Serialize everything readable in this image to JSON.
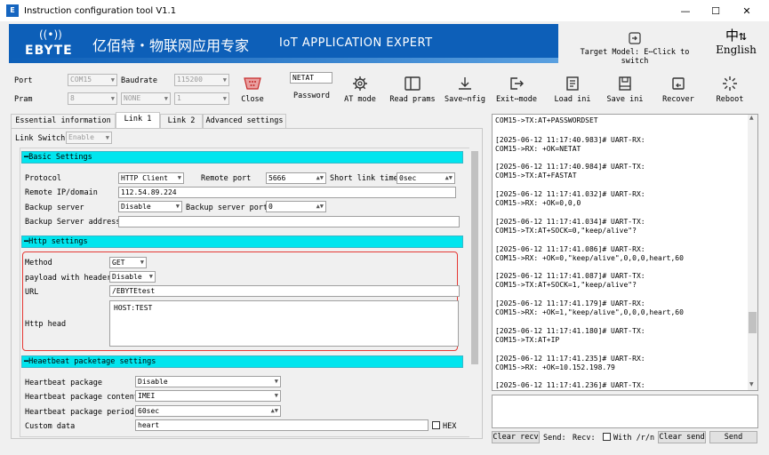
{
  "window": {
    "title": "Instruction configuration tool V1.1",
    "icon_text": "E"
  },
  "banner": {
    "brand": "EBYTE",
    "cn_slogan": "亿佰特・物联网应用专家",
    "en_slogan": "IoT APPLICATION EXPERT"
  },
  "target_model": {
    "label": "Target Model: E⋯Click to switch"
  },
  "language": {
    "label": "English"
  },
  "serial": {
    "port_label": "Port",
    "port_value": "COM15",
    "baud_label": "Baudrate",
    "baud_value": "115200",
    "pram_label": "Pram",
    "pram_data": "8",
    "pram_parity": "NONE",
    "pram_stop": "1",
    "close_label": "Close"
  },
  "password": {
    "value": "NETAT",
    "label": "Password"
  },
  "toolbar": [
    {
      "label": "AT mode",
      "icon": "gear-icon"
    },
    {
      "label": "Read prams",
      "icon": "panel-icon"
    },
    {
      "label": "Save⋯nfig",
      "icon": "download-icon"
    },
    {
      "label": "Exit⋯mode",
      "icon": "exit-icon"
    },
    {
      "label": "Load ini",
      "icon": "document-icon"
    },
    {
      "label": "Save ini",
      "icon": "save-icon"
    },
    {
      "label": "Recover",
      "icon": "recover-icon"
    },
    {
      "label": "Reboot",
      "icon": "spinner-icon"
    }
  ],
  "tabs": [
    "Essential information",
    "Link 1",
    "Link 2",
    "Advanced settings"
  ],
  "link_switch": {
    "label": "Link Switch",
    "value": "Enable"
  },
  "basic": {
    "title": "Basic Settings",
    "protocol_label": "Protocol",
    "protocol_value": "HTTP Client",
    "remote_port_label": "Remote port",
    "remote_port_value": "5666",
    "short_link_label": "Short link time",
    "short_link_value": "0sec",
    "remote_ip_label": "Remote IP/domain",
    "remote_ip_value": "112.54.89.224",
    "backup_label": "Backup server",
    "backup_value": "Disable",
    "backup_port_label": "Backup server port",
    "backup_port_value": "0",
    "backup_addr_label": "Backup Server address",
    "backup_addr_value": ""
  },
  "http": {
    "title": "Http settings",
    "method_label": "Method",
    "method_value": "GET",
    "payload_label": "payload with header",
    "payload_value": "Disable",
    "url_label": "URL",
    "url_value": "/EBYTEtest",
    "head_label": "Http head",
    "head_value": "HOST:TEST"
  },
  "heartbeat": {
    "title": "Heaetbeat packetage settings",
    "pkg_label": "Heartbeat package",
    "pkg_value": "Disable",
    "content_label": "Heartbeat package content",
    "content_value": "IMEI",
    "period_label": "Heartbeat package period",
    "period_value": "60sec",
    "custom_label": "Custom data",
    "custom_value": "heart",
    "hex_label": "HEX"
  },
  "log": [
    [
      "COM15->TX:AT+PASSWORDSET"
    ],
    [
      "[2025-06-12 11:17:40.983]# UART-RX:",
      "COM15->RX: +OK=NETAT"
    ],
    [
      "[2025-06-12 11:17:40.984]# UART-TX:",
      "COM15->TX:AT+FASTAT"
    ],
    [
      "[2025-06-12 11:17:41.032]# UART-RX:",
      "COM15->RX: +OK=0,0,0"
    ],
    [
      "[2025-06-12 11:17:41.034]# UART-TX:",
      "COM15->TX:AT+SOCK=0,\"keep/alive\"?"
    ],
    [
      "[2025-06-12 11:17:41.086]# UART-RX:",
      "COM15->RX: +OK=0,\"keep/alive\",0,0,0,heart,60"
    ],
    [
      "[2025-06-12 11:17:41.087]# UART-TX:",
      "COM15->TX:AT+SOCK=1,\"keep/alive\"?"
    ],
    [
      "[2025-06-12 11:17:41.179]# UART-RX:",
      "COM15->RX: +OK=1,\"keep/alive\",0,0,0,heart,60"
    ],
    [
      "[2025-06-12 11:17:41.180]# UART-TX:",
      "COM15->TX:AT+IP"
    ],
    [
      "[2025-06-12 11:17:41.235]# UART-RX:",
      "COM15->RX: +OK=10.152.198.79"
    ],
    [
      "[2025-06-12 11:17:41.236]# UART-TX:"
    ]
  ],
  "bottom": {
    "clear_recv": "Clear recv",
    "send_label": "Send:",
    "recv_label": "Recv:",
    "with_rn": "With /r/n",
    "clear_send": "Clear send",
    "send_btn": "Send"
  }
}
